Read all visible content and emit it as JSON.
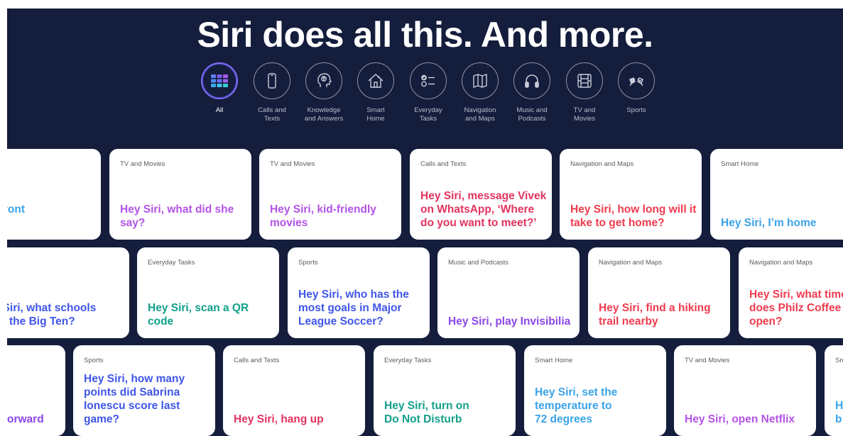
{
  "headline": "Siri does all this. And more.",
  "categories": [
    {
      "label": "All",
      "icon": "grid-icon"
    },
    {
      "label": "Calls and\nTexts",
      "icon": "phone-icon"
    },
    {
      "label": "Knowledge\nand Answers",
      "icon": "brain-head-icon"
    },
    {
      "label": "Smart\nHome",
      "icon": "house-icon"
    },
    {
      "label": "Everyday\nTasks",
      "icon": "checklist-icon"
    },
    {
      "label": "Navigation\nand Maps",
      "icon": "map-icon"
    },
    {
      "label": "Music and\nPodcasts",
      "icon": "headphones-icon"
    },
    {
      "label": "TV and\nMovies",
      "icon": "film-icon"
    },
    {
      "label": "Sports",
      "icon": "flags-icon"
    }
  ],
  "colors": {
    "background": "#141d3c",
    "blue": "#3aa3e8",
    "purple": "#b353e6",
    "pink": "#e2335f",
    "red": "#ef3b4e",
    "indigo": "#3f56e8",
    "green": "#11a08a",
    "violet": "#8a47e8"
  },
  "cards": {
    "r1c0": {
      "category": "",
      "phrase": "i, is the front\ncked?"
    },
    "r1c1": {
      "category": "TV and Movies",
      "phrase": "Hey Siri, what did she say?"
    },
    "r1c2": {
      "category": "TV and Movies",
      "phrase": "Hey Siri, kid-friendly movies"
    },
    "r1c3": {
      "category": "Calls and Texts",
      "phrase": "Hey Siri, message Vivek on WhatsApp, ‘Where do you want to meet?’"
    },
    "r1c4": {
      "category": "Navigation and Maps",
      "phrase": "Hey Siri, how long will it take to get home?"
    },
    "r1c5": {
      "category": "Smart Home",
      "phrase": "Hey Siri, I’m home"
    },
    "r2c0": {
      "category": "orts",
      "phrase": "ey Siri, what schools\ne in the Big Ten?"
    },
    "r2c1": {
      "category": "Everyday Tasks",
      "phrase": "Hey Siri, scan a QR code"
    },
    "r2c2": {
      "category": "Sports",
      "phrase": "Hey Siri, who has the most goals in Major League Soccer?"
    },
    "r2c3": {
      "category": "Music and Podcasts",
      "phrase": "Hey Siri, play Invisibilia"
    },
    "r2c4": {
      "category": "Navigation and Maps",
      "phrase": "Hey Siri, find a hiking trail nearby"
    },
    "r2c5": {
      "category": "Navigation and Maps",
      "phrase": "Hey Siri, what time does Philz Coffee open?"
    },
    "r3c0": {
      "category": "",
      "phrase": "orward"
    },
    "r3c1": {
      "category": "Sports",
      "phrase": "Hey Siri, how many points did Sabrina Ionescu score last game?"
    },
    "r3c2": {
      "category": "Calls and Texts",
      "phrase": "Hey Siri, hang up"
    },
    "r3c3": {
      "category": "Everyday Tasks",
      "phrase": "Hey Siri, turn on Do Not Disturb"
    },
    "r3c4": {
      "category": "Smart Home",
      "phrase": "Hey Siri, set the temperature to 72 degrees"
    },
    "r3c5": {
      "category": "TV and Movies",
      "phrase": "Hey Siri, open Netflix"
    },
    "r3c6": {
      "category": "Sn",
      "phrase": "H\nb"
    }
  }
}
